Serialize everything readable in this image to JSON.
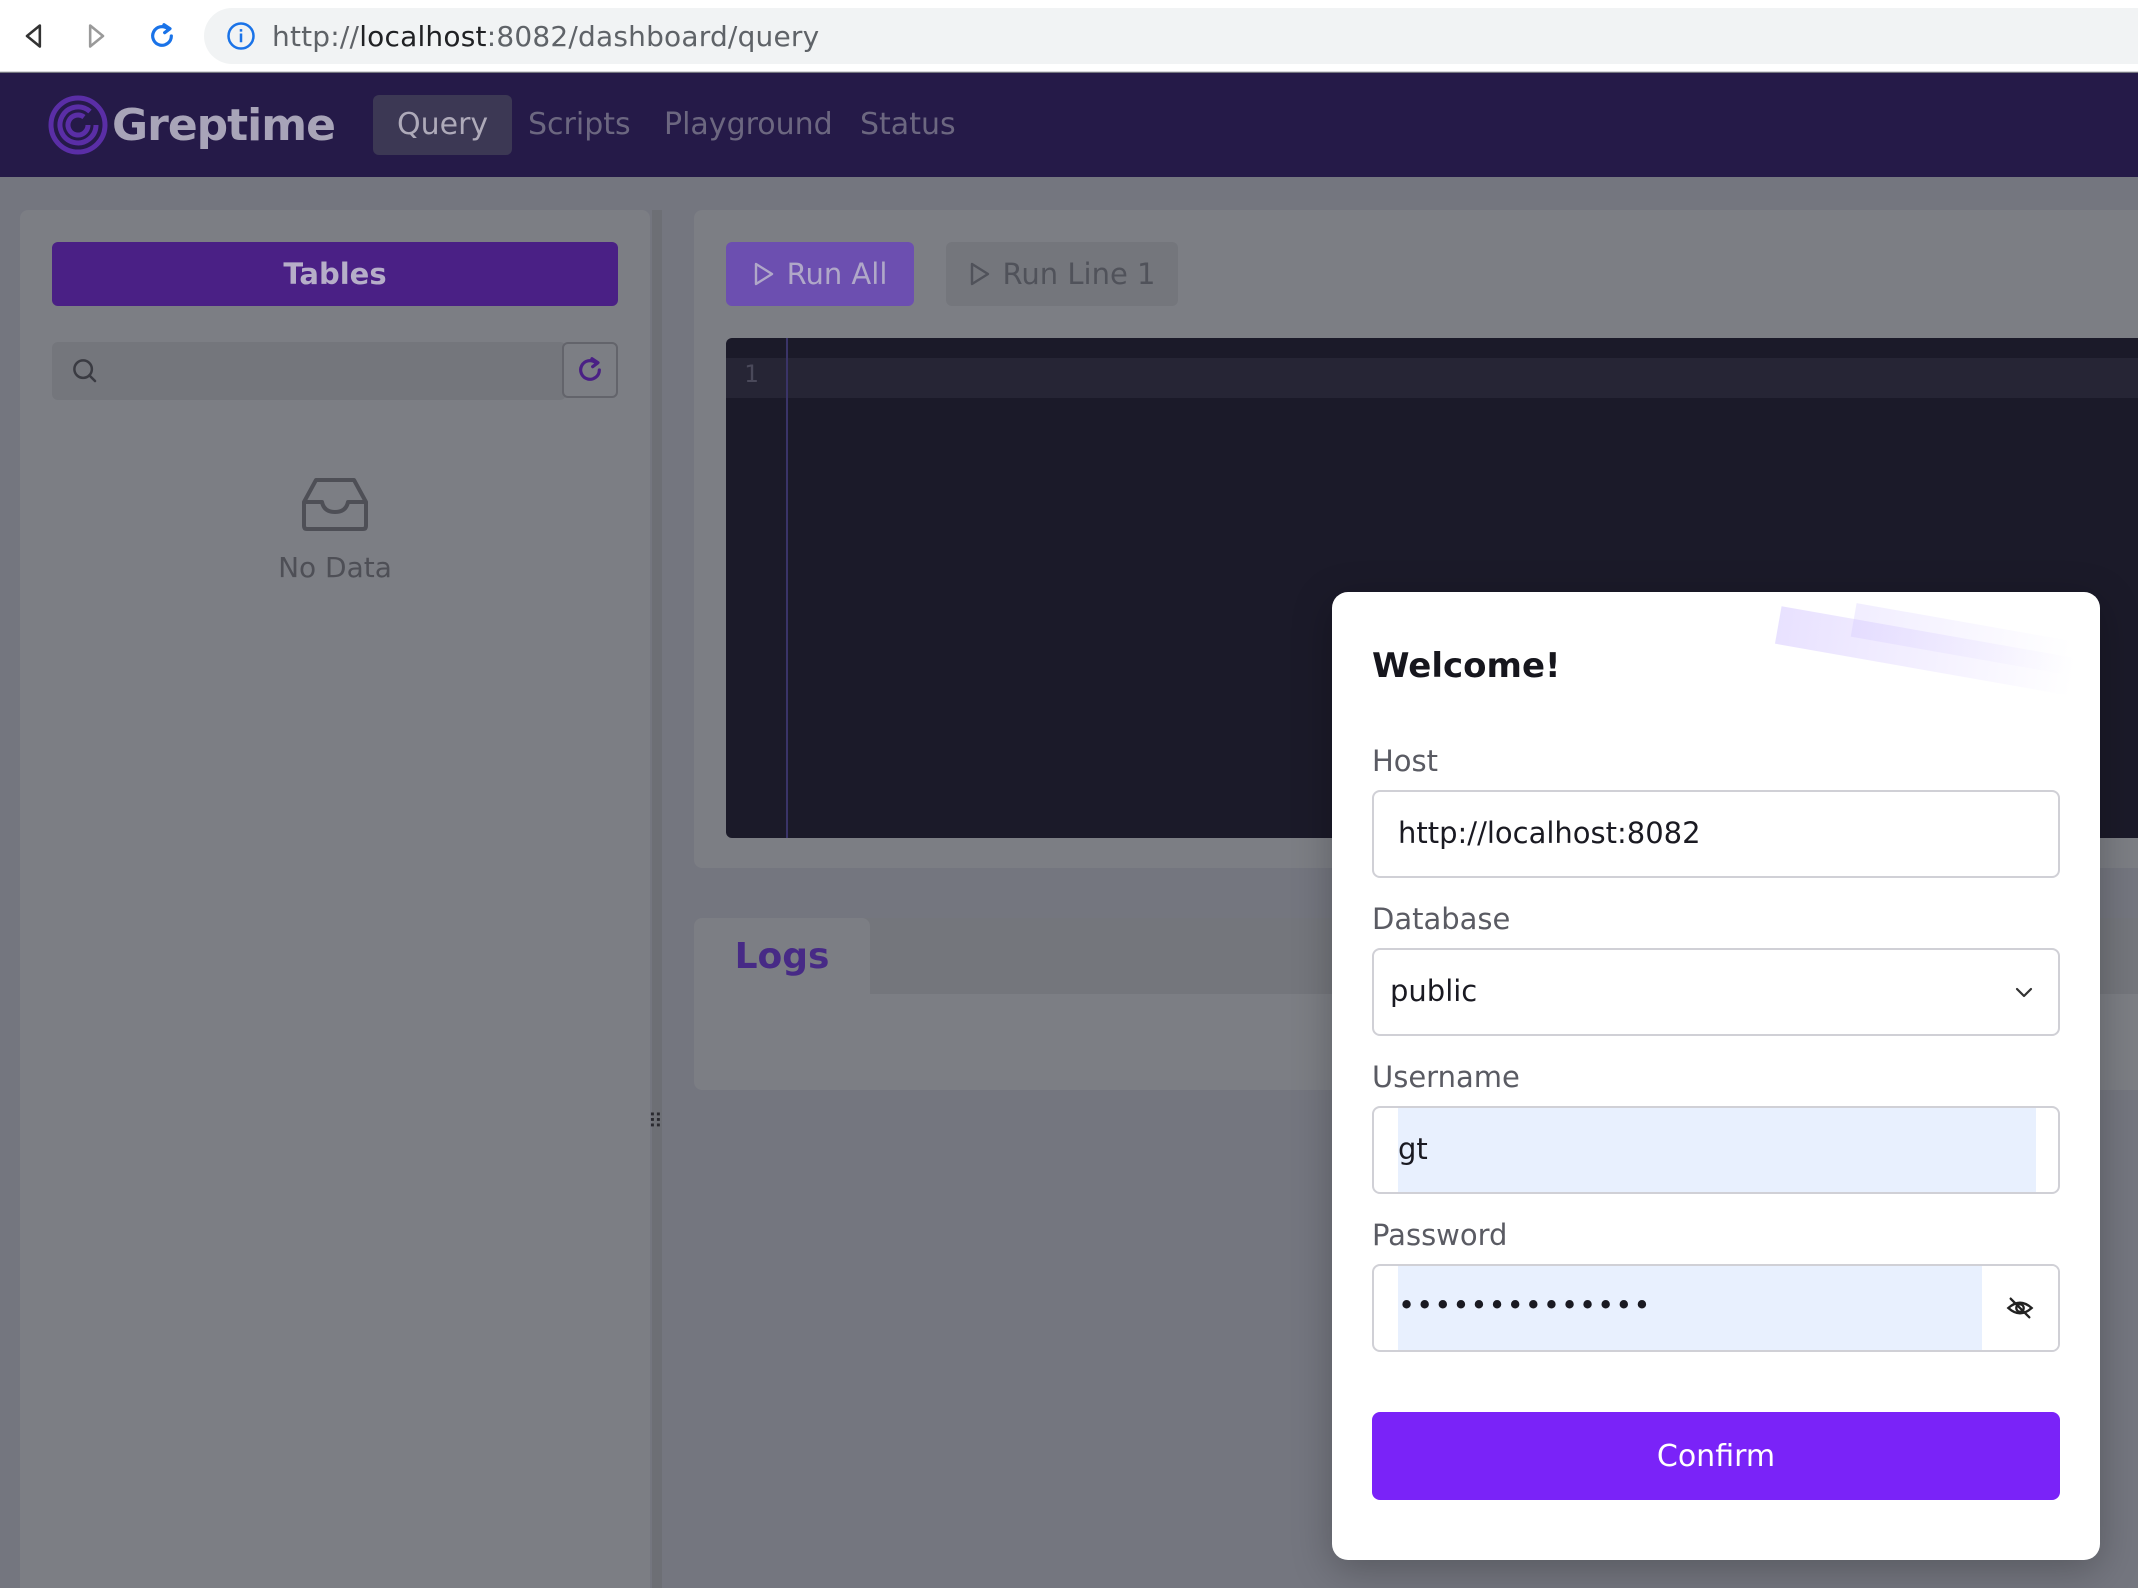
{
  "browser": {
    "url_scheme": "http://",
    "url_host": "localhost",
    "url_rest": ":8082/dashboard/query"
  },
  "app": {
    "logo_text": "Greptime",
    "nav": [
      "Query",
      "Scripts",
      "Playground",
      "Status"
    ],
    "active_nav": "Query"
  },
  "sidebar": {
    "tables_label": "Tables",
    "search_placeholder": "",
    "empty_text": "No Data"
  },
  "editor": {
    "run_all_label": "Run All",
    "run_line_label": "Run Line 1",
    "line_number": "1"
  },
  "logs": {
    "tab_label": "Logs"
  },
  "modal": {
    "title": "Welcome!",
    "host_label": "Host",
    "host_value": "http://localhost:8082",
    "database_label": "Database",
    "database_value": "public",
    "username_label": "Username",
    "username_value": "gt",
    "password_label": "Password",
    "password_mask": "••••••••••••••",
    "confirm_label": "Confirm"
  },
  "colors": {
    "header_bg": "#251a48",
    "primary": "#7a23f8",
    "autofill": "#e8f0fe"
  },
  "icons": {
    "back": "back-arrow-icon",
    "forward": "forward-arrow-icon",
    "reload": "reload-icon",
    "info": "info-icon",
    "search": "search-icon",
    "refresh": "refresh-icon",
    "inbox": "inbox-icon",
    "play": "play-icon",
    "chevron": "chevron-down-icon",
    "eye": "eye-off-icon"
  }
}
